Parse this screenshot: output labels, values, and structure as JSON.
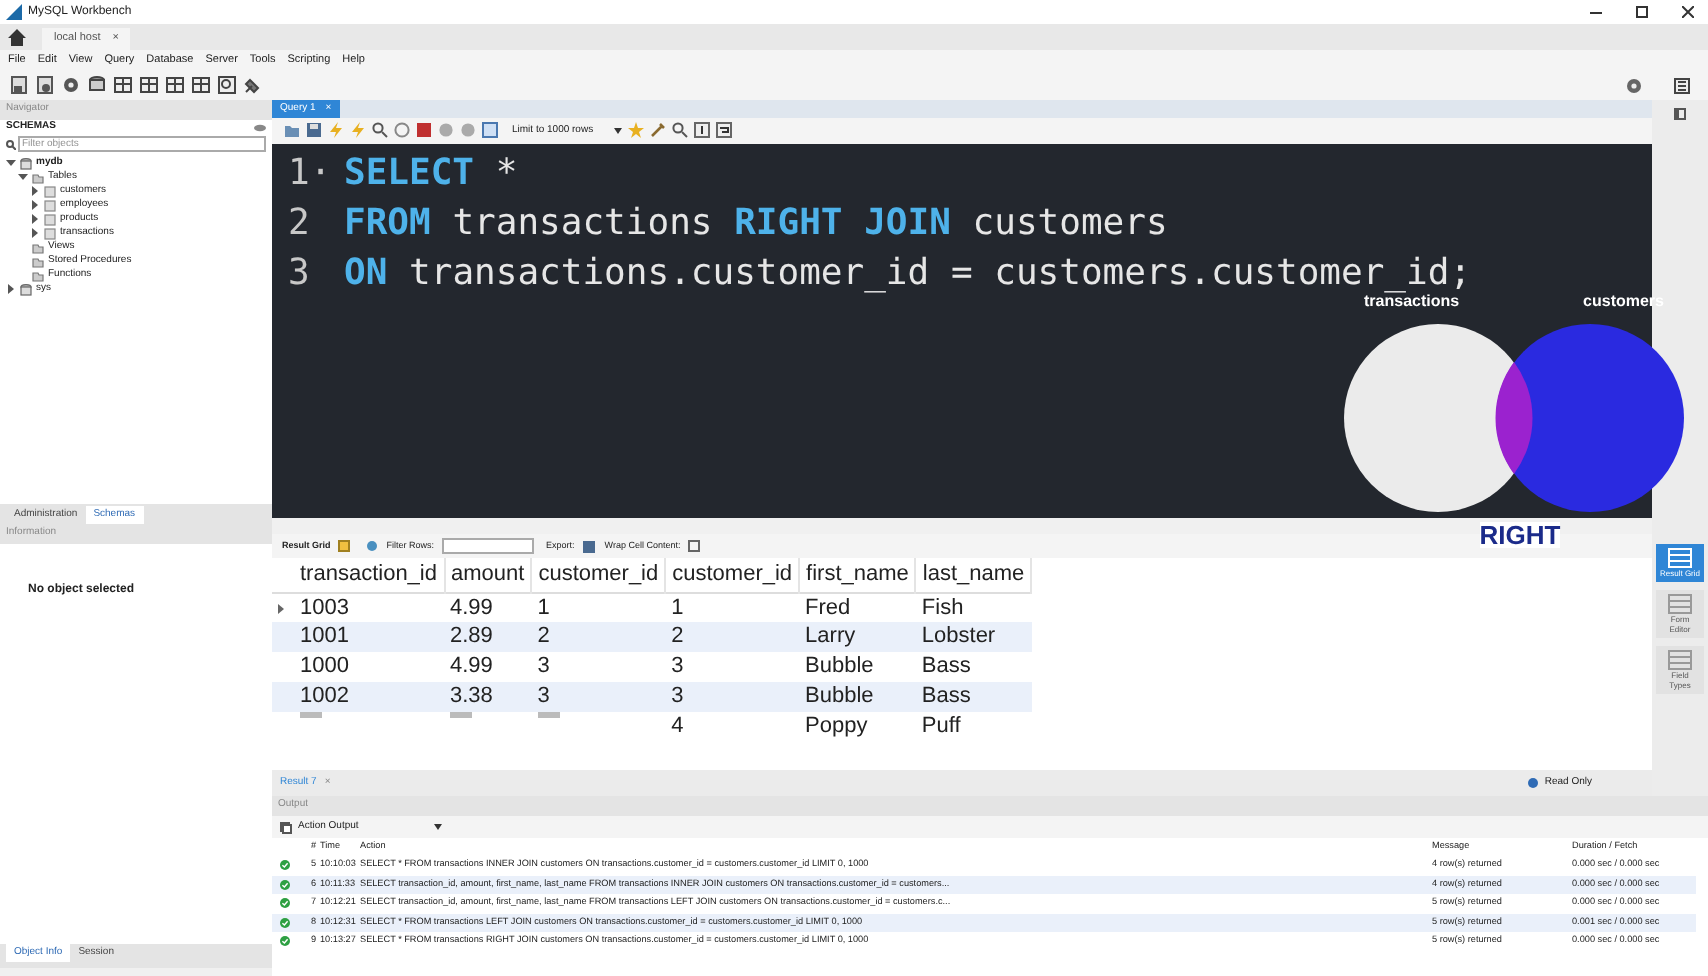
{
  "window": {
    "title": "MySQL Workbench"
  },
  "connection_tab": {
    "label": "local host",
    "close": "×"
  },
  "menu": [
    "File",
    "Edit",
    "View",
    "Query",
    "Database",
    "Server",
    "Tools",
    "Scripting",
    "Help"
  ],
  "navigator": {
    "header": "Navigator",
    "schemas_label": "SCHEMAS",
    "filter_placeholder": "Filter objects",
    "tree": [
      {
        "label": "mydb",
        "kind": "schema",
        "expanded": true,
        "children": [
          {
            "label": "Tables",
            "kind": "folder",
            "expanded": true,
            "children": [
              {
                "label": "customers",
                "kind": "table",
                "expanded": false
              },
              {
                "label": "employees",
                "kind": "table",
                "expanded": false
              },
              {
                "label": "products",
                "kind": "table",
                "expanded": false
              },
              {
                "label": "transactions",
                "kind": "table",
                "expanded": false
              }
            ]
          },
          {
            "label": "Views",
            "kind": "folder"
          },
          {
            "label": "Stored Procedures",
            "kind": "folder"
          },
          {
            "label": "Functions",
            "kind": "folder"
          }
        ]
      },
      {
        "label": "sys",
        "kind": "schema",
        "expanded": false
      }
    ]
  },
  "nav_tabs": [
    {
      "label": "Administration",
      "selected": false
    },
    {
      "label": "Schemas",
      "selected": true
    }
  ],
  "information": {
    "header": "Information",
    "text": "No object selected"
  },
  "info_tabs": [
    {
      "label": "Object Info",
      "selected": true
    },
    {
      "label": "Session",
      "selected": false
    }
  ],
  "query_tab": {
    "label": "Query 1",
    "close": "×"
  },
  "limit_select": "Limit to 1000 rows",
  "editor": {
    "lines": [
      {
        "number": "1·",
        "tokens": [
          {
            "kind": "keyword",
            "text": "SELECT"
          },
          {
            "kind": "plain",
            "text": " *"
          }
        ]
      },
      {
        "number": "2",
        "tokens": [
          {
            "kind": "keyword",
            "text": "FROM"
          },
          {
            "kind": "plain",
            "text": " transactions "
          },
          {
            "kind": "keyword",
            "text": "RIGHT JOIN"
          },
          {
            "kind": "plain",
            "text": " customers"
          }
        ]
      },
      {
        "number": "3",
        "tokens": [
          {
            "kind": "keyword",
            "text": "ON"
          },
          {
            "kind": "plain",
            "text": " transactions.customer_id = customers.customer_id;"
          }
        ]
      }
    ]
  },
  "venn": {
    "left_label": "transactions",
    "right_label": "customers",
    "caption": "RIGHT"
  },
  "result_toolbar": {
    "grid_label": "Result Grid",
    "filter_label": "Filter Rows:",
    "export_label": "Export:",
    "wrap_label": "Wrap Cell Content:"
  },
  "result_table": {
    "columns": [
      "transaction_id",
      "amount",
      "customer_id",
      "customer_id",
      "first_name",
      "last_name"
    ],
    "rows": [
      {
        "current": true,
        "cells": [
          "1003",
          "4.99",
          "1",
          "1",
          "Fred",
          "Fish"
        ]
      },
      {
        "current": false,
        "cells": [
          "1001",
          "2.89",
          "2",
          "2",
          "Larry",
          "Lobster"
        ]
      },
      {
        "current": false,
        "cells": [
          "1000",
          "4.99",
          "3",
          "3",
          "Bubble",
          "Bass"
        ]
      },
      {
        "current": false,
        "cells": [
          "1002",
          "3.38",
          "3",
          "3",
          "Bubble",
          "Bass"
        ]
      },
      {
        "current": false,
        "cells": [
          null,
          null,
          null,
          "4",
          "Poppy",
          "Puff"
        ]
      }
    ]
  },
  "side_buttons": [
    {
      "label": "Result Grid",
      "selected": true
    },
    {
      "label": "Form Editor",
      "selected": false
    },
    {
      "label": "Field Types",
      "selected": false
    }
  ],
  "result_tab": {
    "label": "Result 7",
    "close": "×"
  },
  "read_only": "Read Only",
  "output": {
    "header": "Output",
    "selector": "Action Output",
    "columns": [
      "#",
      "Time",
      "Action",
      "Message",
      "Duration / Fetch"
    ],
    "rows": [
      {
        "success": true,
        "number": "5",
        "time": "10:10:03",
        "action": "SELECT * FROM transactions INNER JOIN customers ON transactions.customer_id = customers.customer_id LIMIT 0, 1000",
        "message": "4 row(s) returned",
        "duration": "0.000 sec / 0.000 sec"
      },
      {
        "success": true,
        "number": "6",
        "time": "10:11:33",
        "action": "SELECT transaction_id, amount, first_name, last_name FROM transactions INNER JOIN customers ON transactions.customer_id = customers...",
        "message": "4 row(s) returned",
        "duration": "0.000 sec / 0.000 sec"
      },
      {
        "success": true,
        "number": "7",
        "time": "10:12:21",
        "action": "SELECT transaction_id, amount, first_name, last_name FROM transactions LEFT JOIN customers ON transactions.customer_id = customers.c...",
        "message": "5 row(s) returned",
        "duration": "0.000 sec / 0.000 sec"
      },
      {
        "success": true,
        "number": "8",
        "time": "10:12:31",
        "action": "SELECT * FROM transactions LEFT JOIN customers ON transactions.customer_id = customers.customer_id LIMIT 0, 1000",
        "message": "5 row(s) returned",
        "duration": "0.001 sec / 0.000 sec"
      },
      {
        "success": true,
        "number": "9",
        "time": "10:13:27",
        "action": "SELECT * FROM transactions RIGHT JOIN customers ON transactions.customer_id = customers.customer_id LIMIT 0, 1000",
        "message": "5 row(s) returned",
        "duration": "0.000 sec / 0.000 sec"
      }
    ]
  }
}
